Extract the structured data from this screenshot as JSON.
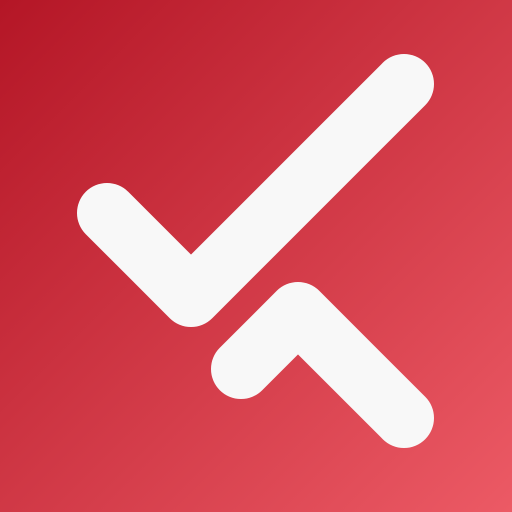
{
  "icon": {
    "name": "checkmark-caret-logo",
    "colors": {
      "gradient_start": "#b41626",
      "gradient_end": "#ec5a65",
      "mark": "#f8f8f8"
    }
  }
}
